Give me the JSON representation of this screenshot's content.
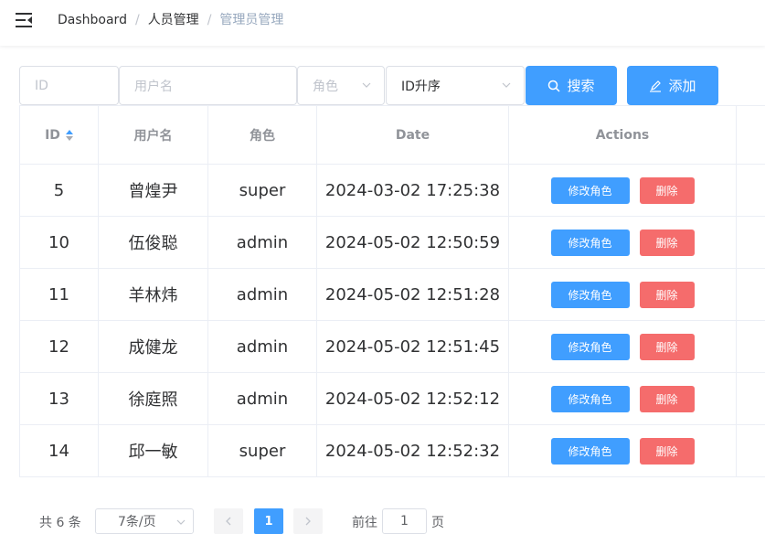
{
  "breadcrumb": [
    "Dashboard",
    "人员管理",
    "管理员管理"
  ],
  "breadcrumb_separator": "/",
  "search": {
    "id_placeholder": "ID",
    "username_placeholder": "用户名",
    "role_placeholder": "角色",
    "sort_value": "ID升序",
    "search_label": "搜索",
    "add_label": "添加"
  },
  "table": {
    "headers": [
      "ID",
      "用户名",
      "角色",
      "Date",
      "Actions"
    ],
    "rows": [
      {
        "id": "5",
        "username": "曾煌尹",
        "role": "super",
        "date": "2024-03-02 17:25:38"
      },
      {
        "id": "10",
        "username": "伍俊聪",
        "role": "admin",
        "date": "2024-05-02 12:50:59"
      },
      {
        "id": "11",
        "username": "羊林炜",
        "role": "admin",
        "date": "2024-05-02 12:51:28"
      },
      {
        "id": "12",
        "username": "成健龙",
        "role": "admin",
        "date": "2024-05-02 12:51:45"
      },
      {
        "id": "13",
        "username": "徐庭照",
        "role": "admin",
        "date": "2024-05-02 12:52:12"
      },
      {
        "id": "14",
        "username": "邱一敏",
        "role": "super",
        "date": "2024-05-02 12:52:32"
      }
    ],
    "edit_label": "修改角色",
    "delete_label": "删除"
  },
  "pagination": {
    "total": "共 6 条",
    "page_size": "7条/页",
    "current_page": "1",
    "goto_prefix": "前往",
    "goto_value": "1",
    "goto_suffix": "页"
  },
  "colors": {
    "primary": "#409eff",
    "danger": "#f56c6c"
  }
}
